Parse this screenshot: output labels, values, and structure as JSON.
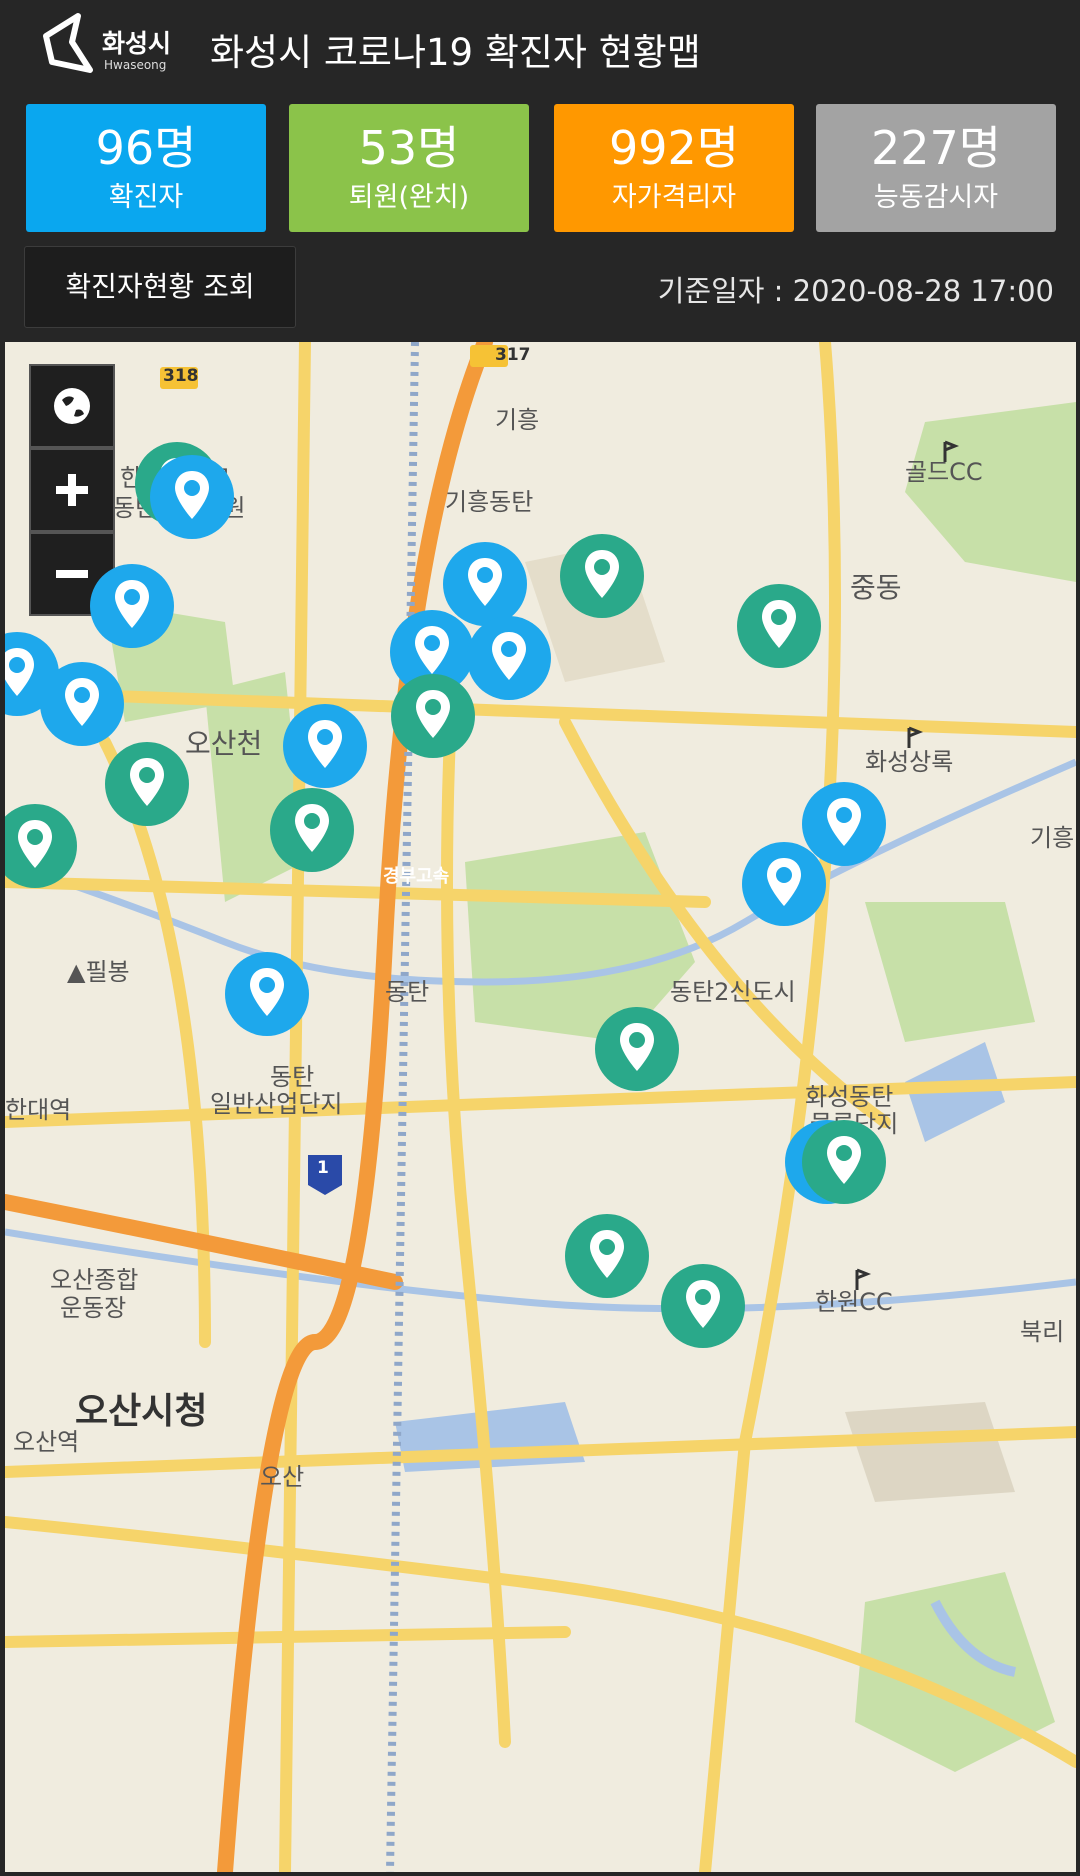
{
  "header": {
    "logo_ko": "화성시",
    "logo_en": "Hwaseong",
    "title": "화성시 코로나19 확진자 현황맵"
  },
  "stats": [
    {
      "value": "96명",
      "label": "확진자",
      "color": "#0aa7ef"
    },
    {
      "value": "53명",
      "label": "퇴원(완치)",
      "color": "#8bc34a"
    },
    {
      "value": "992명",
      "label": "자가격리자",
      "color": "#ff9800"
    },
    {
      "value": "227명",
      "label": "능동감시자",
      "color": "#a3a3a3"
    }
  ],
  "query_button": "확진자현황 조회",
  "reference_date": "기준일자 : 2020-08-28 17:00",
  "map": {
    "controls": [
      "globe-icon",
      "zoom-in-icon",
      "zoom-out-icon"
    ],
    "labels": {
      "giheung": "기흥",
      "giheung_dongtan": "기흥동탄",
      "gold_cc": "골드CC",
      "jungdong": "중동",
      "hallym": "한림대학교",
      "dongtan_hospital": "동탄성심병원",
      "osancheon": "오산천",
      "hwaseong_cc": "화성상록",
      "giheung_right": "기흥",
      "pilbong": "▲필봉",
      "dongtan_jc": "동탄",
      "dongtan2": "동탄2신도시",
      "dongtan_industrial_1": "동탄",
      "dongtan_industrial_2": "일반산업단지",
      "univ_station": "한대역",
      "hwaseong_dongtan_1": "화성동탄",
      "hwaseong_dongtan_2": "물류단지",
      "osan_stadium_1": "오산종합",
      "osan_stadium_2": "운동장",
      "hanwon_cc": "한원CC",
      "bukri": "북리",
      "osan_cityhall": "오산시청",
      "osan_station": "오산역",
      "osan_ic": "오산",
      "route_317": "317",
      "route_318": "318",
      "route_1": "1",
      "gyeongbu": "경부고속"
    },
    "colors": {
      "confirmed_marker": "#1ea8ec",
      "released_marker": "#2aa98a"
    }
  }
}
